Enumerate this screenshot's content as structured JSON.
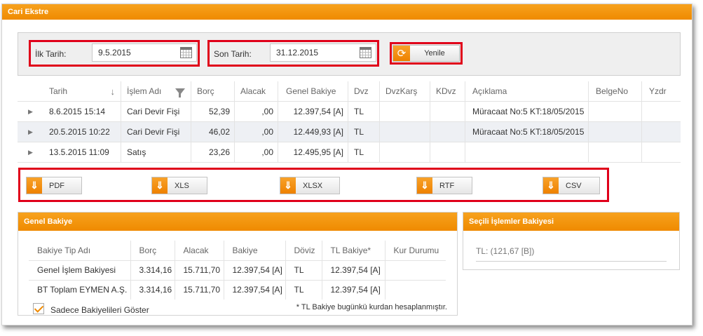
{
  "main": {
    "title": "Cari Ekstre"
  },
  "filters": {
    "start_label": "İlk Tarih:",
    "start_value": "9.5.2015",
    "end_label": "Son Tarih:",
    "end_value": "31.12.2015",
    "refresh_label": "Yenile"
  },
  "grid": {
    "columns": [
      "Tarih",
      "İşlem Adı",
      "Borç",
      "Alacak",
      "Genel Bakiye",
      "Dvz",
      "DvzKarş",
      "KDvz",
      "Açıklama",
      "BelgeNo",
      "Yzdr"
    ],
    "rows": [
      [
        "8.6.2015 15:14",
        "Cari Devir Fişi",
        "52,39",
        ",00",
        "12.397,54 [A]",
        "TL",
        "",
        "",
        "Müracaat No:5 KT:18/05/2015",
        "",
        ""
      ],
      [
        "20.5.2015 10:22",
        "Cari Devir Fişi",
        "46,02",
        ",00",
        "12.449,93 [A]",
        "TL",
        "",
        "",
        "Müracaat No:5 KT:18/05/2015",
        "",
        ""
      ],
      [
        "13.5.2015 11:09",
        "Satış",
        "23,26",
        ",00",
        "12.495,95 [A]",
        "TL",
        "",
        "",
        "",
        "",
        ""
      ]
    ]
  },
  "exports": [
    "PDF",
    "XLS",
    "XLSX",
    "RTF",
    "CSV"
  ],
  "balance": {
    "title": "Genel Bakiye",
    "columns": [
      "Bakiye Tip Adı",
      "Borç",
      "Alacak",
      "Bakiye",
      "Döviz",
      "TL Bakiye*",
      "Kur Durumu"
    ],
    "rows": [
      [
        "Genel İşlem Bakiyesi",
        "3.314,16",
        "15.711,70",
        "12.397,54 [A]",
        "TL",
        "12.397,54 [A]",
        ""
      ],
      [
        "BT Toplam EYMEN A.Ş.",
        "3.314,16",
        "15.711,70",
        "12.397,54 [A]",
        "TL",
        "12.397,54 [A]",
        ""
      ]
    ],
    "checkbox_label": "Sadece Bakiyelileri Göster",
    "checkbox_checked": true,
    "note": "* TL Bakiye bugünkü kurdan hesaplanmıştır."
  },
  "selected": {
    "title": "Seçili İşlemler Bakiyesi",
    "value": "TL: (121,67 [B])"
  },
  "colors": {
    "accent": "#ef8a00",
    "highlight": "#e0001a"
  }
}
